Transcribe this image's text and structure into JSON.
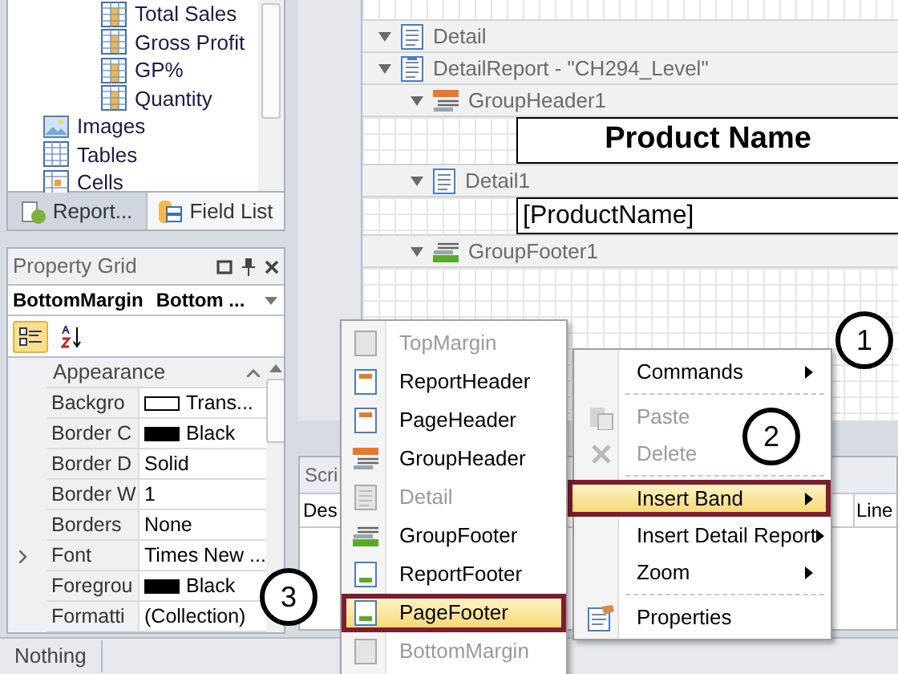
{
  "field_list": {
    "items": [
      {
        "label": "Total Sales",
        "kind": "field"
      },
      {
        "label": "Gross Profit",
        "kind": "field"
      },
      {
        "label": "GP%",
        "kind": "field"
      },
      {
        "label": "Quantity",
        "kind": "field"
      },
      {
        "label": "Images",
        "kind": "images"
      },
      {
        "label": "Tables",
        "kind": "tables"
      },
      {
        "label": "Cells",
        "kind": "cells"
      }
    ]
  },
  "panel_tabs": [
    {
      "label": "Report...",
      "selected": true
    },
    {
      "label": "Field List",
      "selected": false
    }
  ],
  "property_grid": {
    "title": "Property Grid",
    "selector": {
      "name": "BottomMargin",
      "type": "Bottom ..."
    },
    "sort_modes": [
      {
        "kind": "categorized",
        "selected": true
      },
      {
        "kind": "alphabetical",
        "selected": false
      }
    ],
    "category": {
      "label": "Appearance",
      "expanded": true
    },
    "rows": [
      {
        "name": "Backgro",
        "value": "Trans...",
        "color": "#ffffff",
        "expandable": false
      },
      {
        "name": "Border C",
        "value": "Black",
        "color": "#000000",
        "expandable": false
      },
      {
        "name": "Border D",
        "value": "Solid",
        "expandable": false
      },
      {
        "name": "Border W",
        "value": "1",
        "expandable": false
      },
      {
        "name": "Borders",
        "value": "None",
        "expandable": false
      },
      {
        "name": "Font",
        "value": "Times New ...",
        "expandable": true
      },
      {
        "name": "Foregrou",
        "value": "Black",
        "color": "#000000",
        "expandable": false
      },
      {
        "name": "Formatti",
        "value": "(Collection)",
        "expandable": false
      }
    ]
  },
  "design": {
    "bands": [
      {
        "label": "Detail",
        "kind": "detail",
        "expanded": true
      },
      {
        "label": "DetailReport - \"CH294_Level\"",
        "kind": "detail-report",
        "expanded": true,
        "children": [
          {
            "label": "GroupHeader1",
            "kind": "group-header",
            "expanded": true,
            "cell": "Product Name"
          },
          {
            "label": "Detail1",
            "kind": "detail",
            "expanded": true,
            "cell": "[ProductName]"
          },
          {
            "label": "GroupFooter1",
            "kind": "group-footer",
            "expanded": true
          }
        ]
      }
    ]
  },
  "script_panel": {
    "tab": "Scri",
    "columns": [
      "Des",
      "Line"
    ]
  },
  "context_menu": {
    "items": [
      {
        "kind": "command",
        "label": "Commands",
        "submenu": true,
        "disabled": false,
        "selected": false
      },
      {
        "kind": "separator"
      },
      {
        "kind": "paste",
        "label": "Paste",
        "submenu": false,
        "disabled": true,
        "selected": false
      },
      {
        "kind": "delete",
        "label": "Delete",
        "submenu": false,
        "disabled": true,
        "selected": false
      },
      {
        "kind": "separator"
      },
      {
        "kind": "command",
        "label": "Insert Band",
        "submenu": true,
        "disabled": false,
        "selected": true
      },
      {
        "kind": "command",
        "label": "Insert Detail Report",
        "submenu": true,
        "disabled": false,
        "selected": false
      },
      {
        "kind": "command",
        "label": "Zoom",
        "submenu": true,
        "disabled": false,
        "selected": false
      },
      {
        "kind": "separator"
      },
      {
        "kind": "properties",
        "label": "Properties",
        "submenu": false,
        "disabled": false,
        "selected": false
      }
    ]
  },
  "band_submenu": {
    "items": [
      {
        "label": "TopMargin",
        "kind": "top-margin",
        "disabled": true,
        "selected": false
      },
      {
        "label": "ReportHeader",
        "kind": "report-header",
        "disabled": false,
        "selected": false
      },
      {
        "label": "PageHeader",
        "kind": "page-header",
        "disabled": false,
        "selected": false
      },
      {
        "label": "GroupHeader",
        "kind": "group-header",
        "disabled": false,
        "selected": false
      },
      {
        "label": "Detail",
        "kind": "detail",
        "disabled": true,
        "selected": false
      },
      {
        "label": "GroupFooter",
        "kind": "group-footer",
        "disabled": false,
        "selected": false
      },
      {
        "label": "ReportFooter",
        "kind": "report-footer",
        "disabled": false,
        "selected": false
      },
      {
        "label": "PageFooter",
        "kind": "page-footer",
        "disabled": false,
        "selected": true
      },
      {
        "label": "BottomMargin",
        "kind": "bottom-margin",
        "disabled": true,
        "selected": false
      }
    ]
  },
  "callouts": [
    "1",
    "2",
    "3"
  ],
  "status_bar": {
    "text": "Nothing"
  }
}
